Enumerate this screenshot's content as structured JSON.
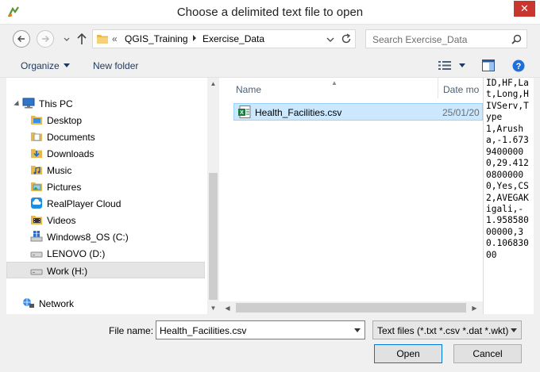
{
  "window": {
    "title": "Choose a delimited text file to open",
    "close_label": "✕"
  },
  "address": {
    "overflow": "«",
    "parts": [
      "QGIS_Training",
      "Exercise_Data"
    ]
  },
  "search": {
    "placeholder": "Search Exercise_Data"
  },
  "toolbar": {
    "organize_label": "Organize",
    "new_folder_label": "New folder"
  },
  "nav_pane": {
    "items": [
      {
        "label": "This PC",
        "icon": "computer-icon"
      },
      {
        "label": "Desktop",
        "icon": "desktop-folder-icon"
      },
      {
        "label": "Documents",
        "icon": "documents-folder-icon"
      },
      {
        "label": "Downloads",
        "icon": "downloads-folder-icon"
      },
      {
        "label": "Music",
        "icon": "music-folder-icon"
      },
      {
        "label": "Pictures",
        "icon": "pictures-folder-icon"
      },
      {
        "label": "RealPlayer Cloud",
        "icon": "realplayer-cloud-icon"
      },
      {
        "label": "Videos",
        "icon": "videos-folder-icon"
      },
      {
        "label": "Windows8_OS (C:)",
        "icon": "windows-drive-icon"
      },
      {
        "label": "LENOVO (D:)",
        "icon": "drive-icon"
      },
      {
        "label": "Work (H:)",
        "icon": "drive-icon"
      },
      {
        "label": "Network",
        "icon": "network-icon"
      }
    ]
  },
  "file_list": {
    "columns": {
      "name": "Name",
      "date": "Date mo"
    },
    "files": [
      {
        "name": "Health_Facilities.csv",
        "date": "25/01/20",
        "icon": "csv-file-icon"
      }
    ]
  },
  "preview": {
    "text": "ID,HF,Lat,Long,HIVServ,Type\n1,Arusha,-1.67394000000,29.41208000000,Yes,CS2,AVEGAKigali,-1.95858000000,30.10683000"
  },
  "bottom": {
    "file_name_label": "File name:",
    "file_name_value": "Health_Facilities.csv",
    "file_type_value": "Text files (*.txt *.csv *.dat *.wkt)",
    "open_label": "Open",
    "cancel_label": "Cancel"
  },
  "colors": {
    "selection": "#cce8ff",
    "close_button": "#c7372f",
    "link_text": "#1e395b"
  }
}
